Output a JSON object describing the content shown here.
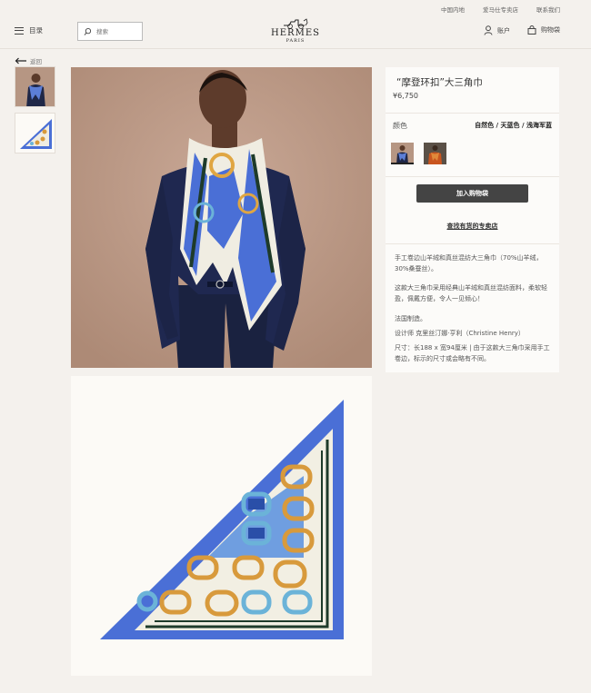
{
  "top_links": [
    "中国内地",
    "爱马仕专卖店",
    "联系我们"
  ],
  "header": {
    "menu_label": "目录",
    "search_placeholder": "搜索",
    "logo_brand": "HERMES",
    "logo_city": "PARIS",
    "account_label": "账户",
    "bag_label": "购物袋"
  },
  "back_label": "返回",
  "product": {
    "title": "“摩登环扣”大三角巾",
    "price": "¥6,750",
    "color_label": "颜色",
    "color_value": "自然色 / 天蓝色 / 浅海军蓝",
    "add_to_bag": "加入购物袋",
    "find_store": "查找有货的专卖店",
    "description": [
      "手工卷边山羊绒和真丝混纺大三角巾（70%山羊绒，30%桑蚕丝）。",
      "这款大三角巾采用经典山羊绒和真丝混纺面料，柔软轻盈，佩戴方便，令人一见倾心！",
      "法国制造。",
      "设计师 克里丝汀娜·亨利（Christine Henry）",
      "尺寸：长188 x 宽94厘米 | 由于这款大三角巾采用手工卷边，标示的尺寸或会略有不同。"
    ]
  },
  "colors": {
    "background": "#f4f1ed",
    "panel": "#fcfbf9",
    "button": "#444444",
    "scarf_blue": "#4a6fd6"
  }
}
